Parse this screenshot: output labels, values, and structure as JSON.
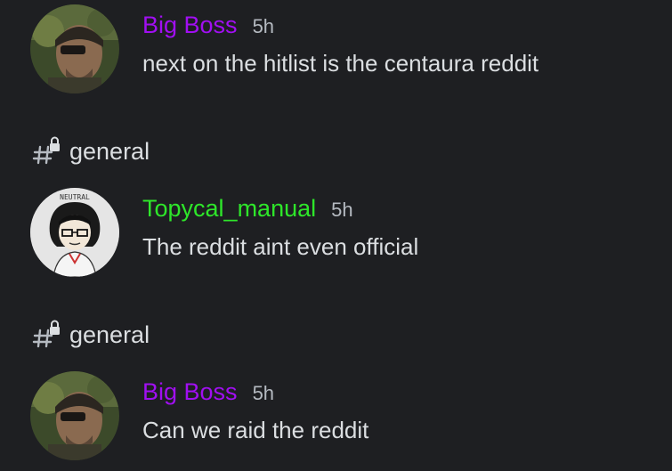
{
  "colors": {
    "background": "#1e1f22",
    "bigboss_name": "#a10ff2",
    "topycal_name": "#2ee62a",
    "text": "#dbdee1",
    "muted": "#b5bac1"
  },
  "messages": [
    {
      "author": "Big Boss",
      "time": "5h",
      "content": "next on the hitlist is the centaura reddit",
      "avatar_icon": "snake-portrait-avatar"
    },
    {
      "author": "Topycal_manual",
      "time": "5h",
      "content": "The reddit aint even official",
      "avatar_icon": "neutral-cartoon-avatar",
      "avatar_caption": "NEUTRAL"
    },
    {
      "author": "Big Boss",
      "time": "5h",
      "content": "Can we raid the reddit",
      "avatar_icon": "snake-portrait-avatar"
    }
  ],
  "channels": [
    {
      "name": "general",
      "icon": "locked-hashtag-icon"
    },
    {
      "name": "general",
      "icon": "locked-hashtag-icon"
    }
  ]
}
